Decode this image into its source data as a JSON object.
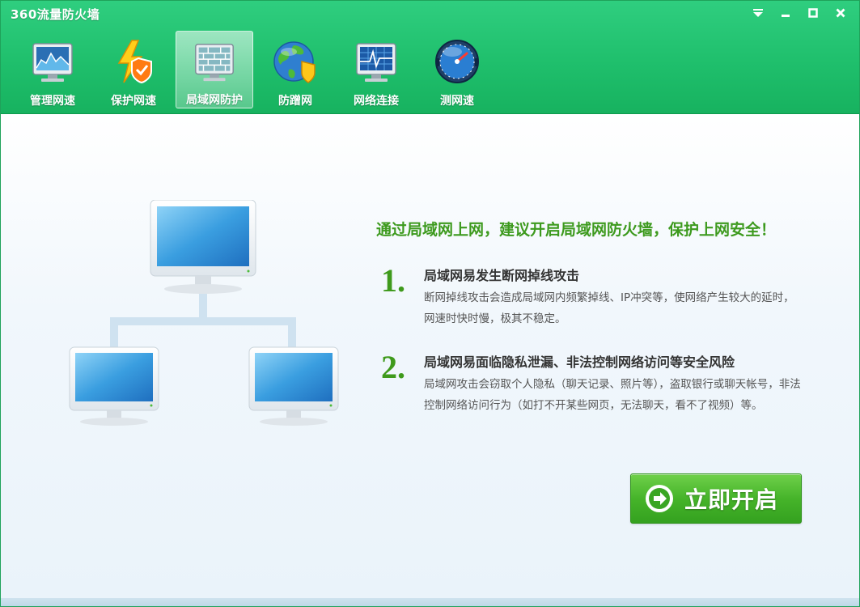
{
  "app": {
    "title": "360流量防火墙"
  },
  "window_controls": {
    "menu_icon": "dropdown-triangle-icon",
    "minimize_icon": "minimize-icon",
    "maximize_icon": "maximize-icon",
    "close_icon": "close-icon"
  },
  "toolbar": {
    "items": [
      {
        "label": "管理网速",
        "icon": "monitor-chart-icon",
        "active": false
      },
      {
        "label": "保护网速",
        "icon": "lightning-shield-icon",
        "active": false
      },
      {
        "label": "局域网防护",
        "icon": "brick-wall-icon",
        "active": true
      },
      {
        "label": "防蹭网",
        "icon": "globe-shield-icon",
        "active": false
      },
      {
        "label": "网络连接",
        "icon": "network-monitor-icon",
        "active": false
      },
      {
        "label": "测网速",
        "icon": "speedometer-icon",
        "active": false
      }
    ]
  },
  "main": {
    "headline": "通过局域网上网，建议开启局域网防火墙，保护上网安全！",
    "items": [
      {
        "num": "1.",
        "title": "局域网易发生断网掉线攻击",
        "desc": "断网掉线攻击会造成局域网内频繁掉线、IP冲突等，使网络产生较大的延时，网速时快时慢，极其不稳定。"
      },
      {
        "num": "2.",
        "title": "局域网易面临隐私泄漏、非法控制网络访问等安全风险",
        "desc": "局域网攻击会窃取个人隐私（聊天记录、照片等），盗取银行或聊天帐号，非法控制网络访问行为（如打不开某些网页，无法聊天，看不了视频）等。"
      }
    ],
    "start_button": {
      "label": "立即开启",
      "icon": "arrow-circle-right-icon"
    }
  },
  "colors": {
    "header_green": "#1fbf6c",
    "headline_green": "#3d9a1e",
    "button_green": "#46b42a"
  }
}
